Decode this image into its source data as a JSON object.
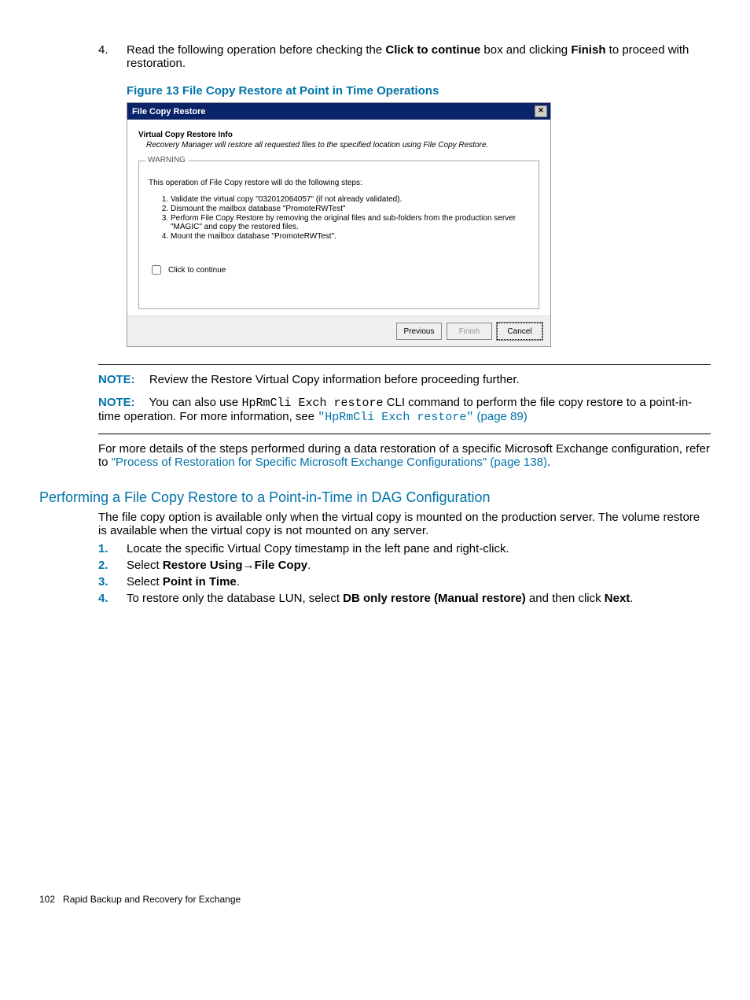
{
  "step4": {
    "num": "4.",
    "pre": "Read the following operation before checking the ",
    "bold1": "Click to continue",
    "mid": " box and clicking ",
    "bold2": "Finish",
    "post": " to proceed with restoration."
  },
  "figure_caption": "Figure 13 File Copy Restore at Point in Time Operations",
  "dialog": {
    "title": "File Copy Restore",
    "info_title": "Virtual Copy Restore Info",
    "info_text": "Recovery Manager will restore all requested files to the specified location using File Copy Restore.",
    "warning_legend": "WARNING",
    "intro": "This operation of File Copy restore will do the following steps:",
    "steps": [
      "Validate the virtual copy \"032012064057\" (if not already validated).",
      "Dismount the mailbox database \"PromoteRWTest\"",
      "Perform File Copy Restore by removing the original files and sub-folders from the production server \"MAGIC\" and copy the restored files.",
      "Mount the mailbox database \"PromoteRWTest\"."
    ],
    "continue_label": "Click to continue",
    "btn_prev": "Previous",
    "btn_finish": "Finish",
    "btn_cancel": "Cancel"
  },
  "note1": {
    "label": "NOTE:",
    "text": "Review the Restore Virtual Copy information before proceeding further."
  },
  "note2": {
    "label": "NOTE:",
    "pre": "You can also use ",
    "cmd": "HpRmCli Exch restore",
    "mid": " CLI command to perform the file copy restore to a point-in-time operation. For more information, see ",
    "link_cmd": "\"HpRmCli Exch restore\"",
    "link_page": " (page 89)"
  },
  "detail_para": {
    "pre": "For more details of the steps performed during a data restoration of a specific Microsoft Exchange configuration, refer to ",
    "link": "\"Process of Restoration for Specific Microsoft Exchange Configurations\" (page 138)",
    "post": "."
  },
  "section_heading": "Performing a File Copy Restore to a Point-in-Time in DAG Configuration",
  "section_intro": "The file copy option is available only when the virtual copy is mounted on the production server. The volume restore is available when the virtual copy is not mounted on any server.",
  "list": {
    "i1": {
      "num": "1.",
      "text": "Locate the specific Virtual Copy timestamp in the left pane and right-click."
    },
    "i2": {
      "num": "2.",
      "pre": "Select ",
      "b1": "Restore Using",
      "arrow": "→",
      "b2": "File Copy",
      "post": "."
    },
    "i3": {
      "num": "3.",
      "pre": "Select ",
      "b1": "Point in Time",
      "post": "."
    },
    "i4": {
      "num": "4.",
      "pre": "To restore only the database LUN, select ",
      "b1": "DB only restore (Manual restore)",
      "mid": " and then click ",
      "b2": "Next",
      "post": "."
    }
  },
  "footer": {
    "pagenum": "102",
    "chapter": "Rapid Backup and Recovery for Exchange"
  }
}
